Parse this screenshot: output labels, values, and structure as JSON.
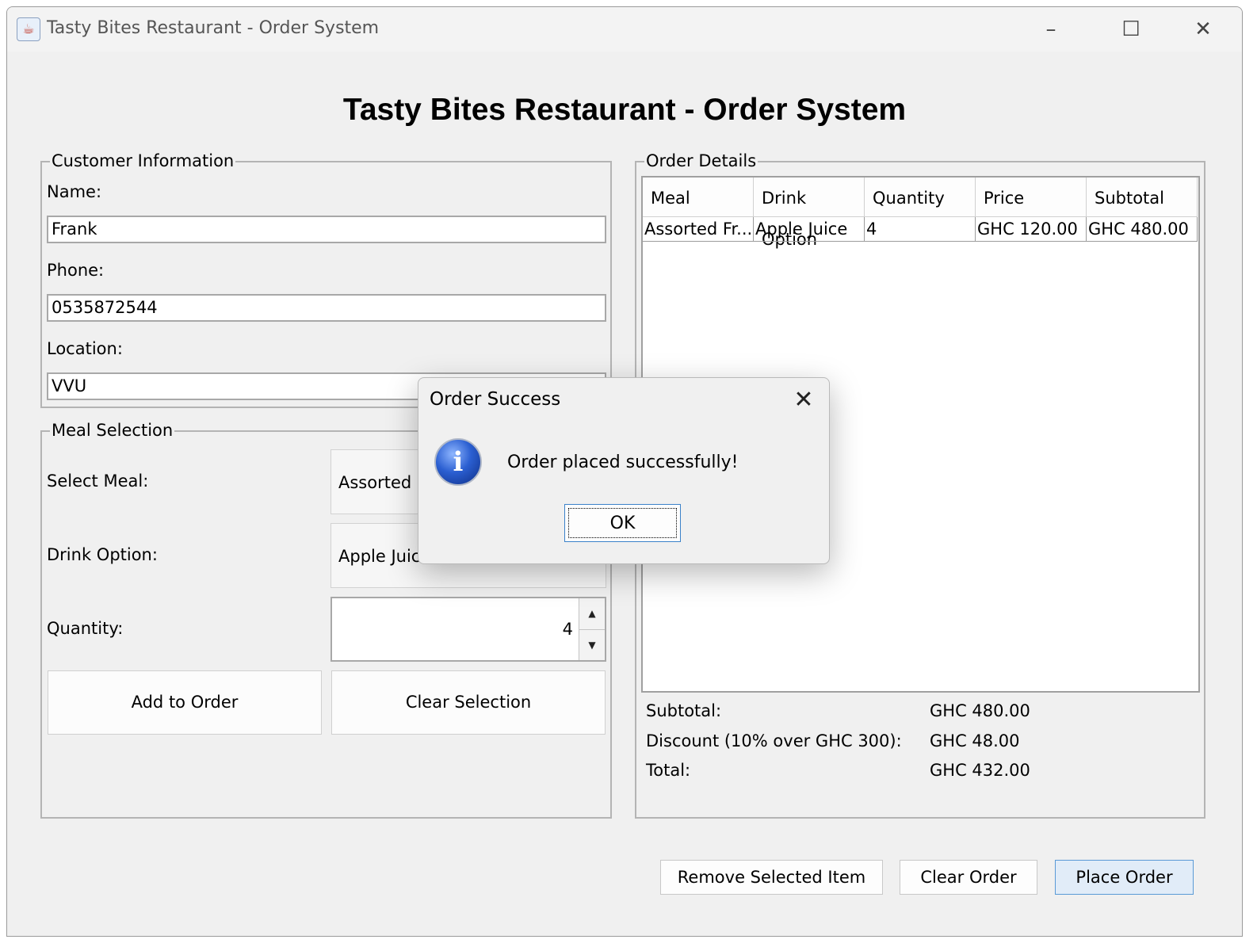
{
  "window": {
    "title": "Tasty Bites Restaurant - Order System",
    "controls": {
      "minimize": "–",
      "maximize": "☐",
      "close": "✕"
    }
  },
  "heading": "Tasty Bites Restaurant - Order System",
  "customer": {
    "group_title": "Customer Information",
    "name_label": "Name:",
    "name_value": "Frank",
    "phone_label": "Phone:",
    "phone_value": "0535872544",
    "location_label": "Location:",
    "location_value": "VVU"
  },
  "meal": {
    "group_title": "Meal Selection",
    "select_meal_label": "Select Meal:",
    "select_meal_value": "Assorted F",
    "drink_label": "Drink Option:",
    "drink_value": "Apple Juice",
    "quantity_label": "Quantity:",
    "quantity_value": "4",
    "add_button": "Add to Order",
    "clear_selection_button": "Clear Selection"
  },
  "order": {
    "group_title": "Order Details",
    "columns": [
      "Meal",
      "Drink Option",
      "Quantity",
      "Price",
      "Subtotal"
    ],
    "rows": [
      [
        "Assorted Fr...",
        "Apple Juice",
        "4",
        "GHC 120.00",
        "GHC 480.00"
      ]
    ],
    "subtotal_label": "Subtotal:",
    "subtotal_value": "GHC 480.00",
    "discount_label": "Discount (10% over GHC 300):",
    "discount_value": "GHC 48.00",
    "total_label": "Total:",
    "total_value": "GHC 432.00"
  },
  "actions": {
    "remove": "Remove Selected Item",
    "clear": "Clear Order",
    "place": "Place Order"
  },
  "dialog": {
    "title": "Order Success",
    "message": "Order placed successfully!",
    "ok": "OK",
    "icon": "info-icon"
  },
  "colors": {
    "window_bg": "#f0f0f0",
    "primary_button_bg": "#e1ecf8",
    "primary_button_border": "#5a9ad6"
  }
}
